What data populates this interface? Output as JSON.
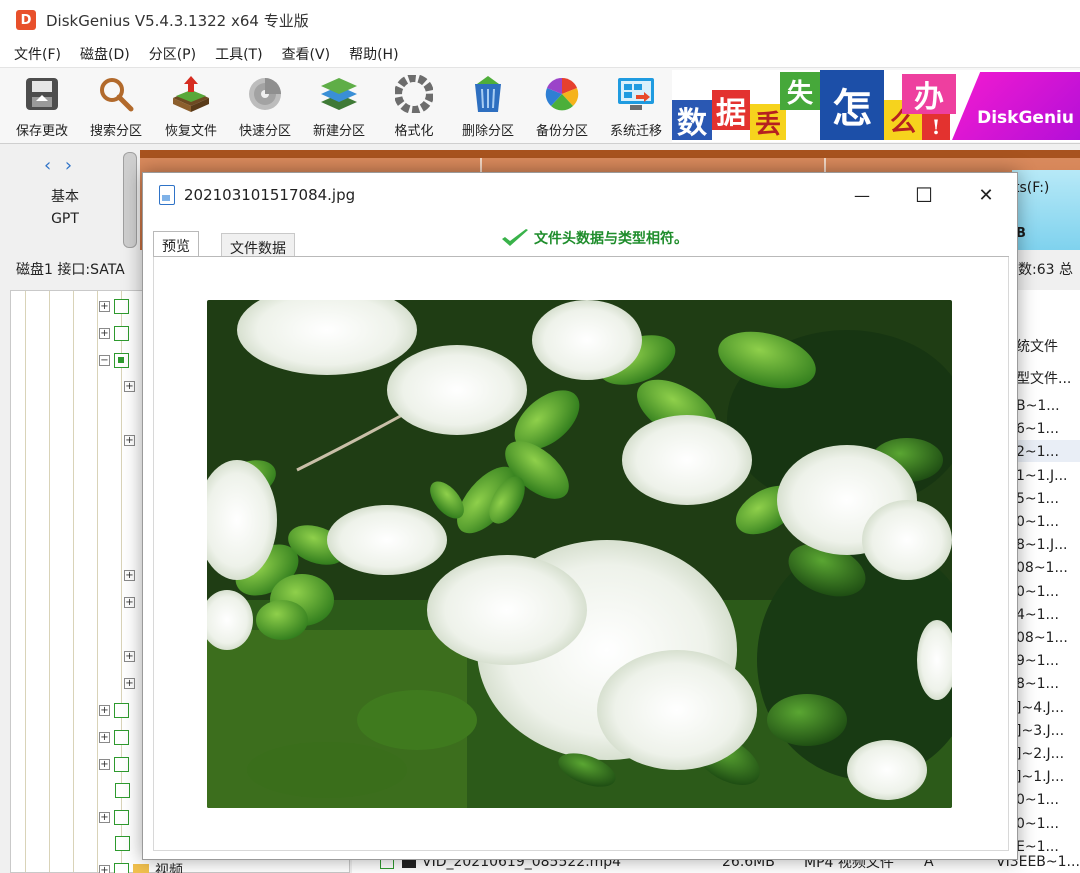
{
  "app": {
    "logo_letter": "D",
    "title": "DiskGenius V5.4.3.1322 x64 专业版"
  },
  "menu": [
    {
      "label": "文件(F)"
    },
    {
      "label": "磁盘(D)"
    },
    {
      "label": "分区(P)"
    },
    {
      "label": "工具(T)"
    },
    {
      "label": "查看(V)"
    },
    {
      "label": "帮助(H)"
    }
  ],
  "toolbar": [
    {
      "label": "保存更改",
      "icon": "save-icon"
    },
    {
      "label": "搜索分区",
      "icon": "search-partition-icon"
    },
    {
      "label": "恢复文件",
      "icon": "recover-file-icon"
    },
    {
      "label": "快速分区",
      "icon": "quick-partition-icon"
    },
    {
      "label": "新建分区",
      "icon": "new-partition-icon"
    },
    {
      "label": "格式化",
      "icon": "format-icon"
    },
    {
      "label": "删除分区",
      "icon": "delete-partition-icon"
    },
    {
      "label": "备份分区",
      "icon": "backup-partition-icon"
    },
    {
      "label": "系统迁移",
      "icon": "system-migrate-icon"
    }
  ],
  "banner": {
    "chars": [
      "数",
      "据",
      "丢",
      "失",
      "怎",
      "么",
      "办",
      "!"
    ],
    "brand": "DiskGeniu"
  },
  "disk": {
    "nav": "‹ ›",
    "type_line1": "基本",
    "type_line2": "GPT",
    "info": "磁盘1 接口:SATA",
    "info_right": "数:63 总",
    "partition_label": "ts(F:)",
    "partition_unit": "B"
  },
  "file_list": {
    "header": "统文件",
    "subheader": "型文件...",
    "rows": [
      "B~1...",
      "6~1...",
      "2~1...",
      "1~1.J...",
      "5~1...",
      "0~1...",
      "8~1.J...",
      "08~1...",
      "0~1...",
      "4~1...",
      "08~1...",
      "9~1...",
      "8~1...",
      "]~4.J...",
      "]~3.J...",
      "]~2.J...",
      "]~1.J...",
      "0~1...",
      "0~1...",
      "E~1..."
    ],
    "bottom_row": {
      "name": "VID_20210619_085522.mp4",
      "size": "26.6MB",
      "type": "MP4 视频文件",
      "attr": "A",
      "short": "VI3EEB~1..."
    },
    "tree_folder_label": "视频"
  },
  "dialog": {
    "title": "202103101517084.jpg",
    "tabs": [
      {
        "label": "预览"
      },
      {
        "label": "文件数据"
      }
    ],
    "status": "文件头数据与类型相符。",
    "minimize": "—",
    "maximize": "☐",
    "close": "✕",
    "status_color": "#1f8d2c"
  },
  "colors": {
    "partition": "#c46d3e",
    "partition_f": "#7fd2ee",
    "checkbox": "#2e9a2e",
    "accent": "#2f73c7"
  }
}
